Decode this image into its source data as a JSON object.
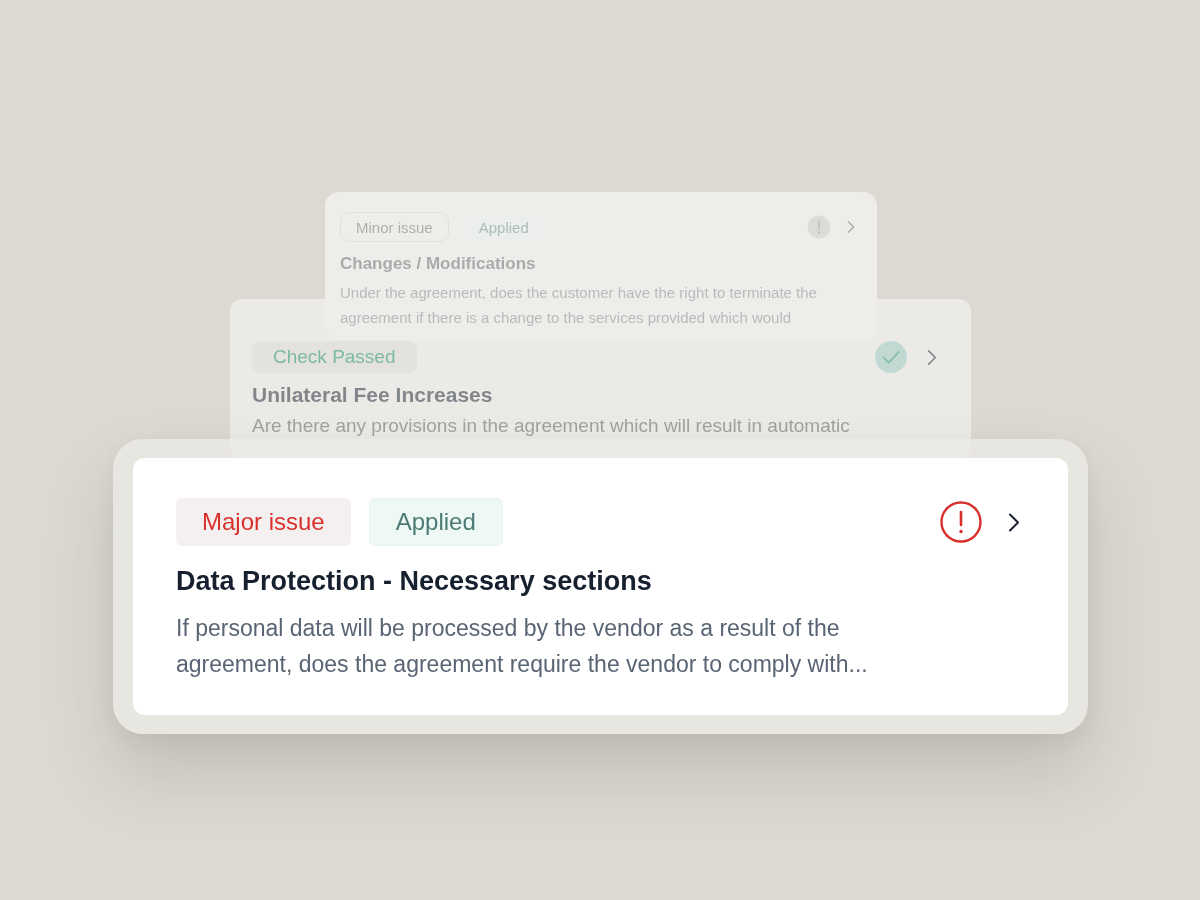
{
  "cards": [
    {
      "tags": [
        {
          "label": "Minor issue",
          "kind": "minor"
        },
        {
          "label": "Applied",
          "kind": "applied"
        }
      ],
      "kind": "minor",
      "title": "Changes / Modifications",
      "description": "Under the agreement, does the customer have the right to terminate the agreement if there is a change to the services provided which would"
    },
    {
      "tags": [
        {
          "label": "Check Passed",
          "kind": "passed"
        }
      ],
      "kind": "passed",
      "title": "Unilateral Fee Increases",
      "description": "Are there any provisions in the agreement which will result in automatic"
    },
    {
      "tags": [
        {
          "label": "Major issue",
          "kind": "major"
        },
        {
          "label": "Applied",
          "kind": "applied"
        }
      ],
      "kind": "major",
      "title": "Data Protection - Necessary sections",
      "description": "If personal data will be processed by the vendor as a result of the agreement, does the agreement require the vendor to comply with..."
    }
  ]
}
